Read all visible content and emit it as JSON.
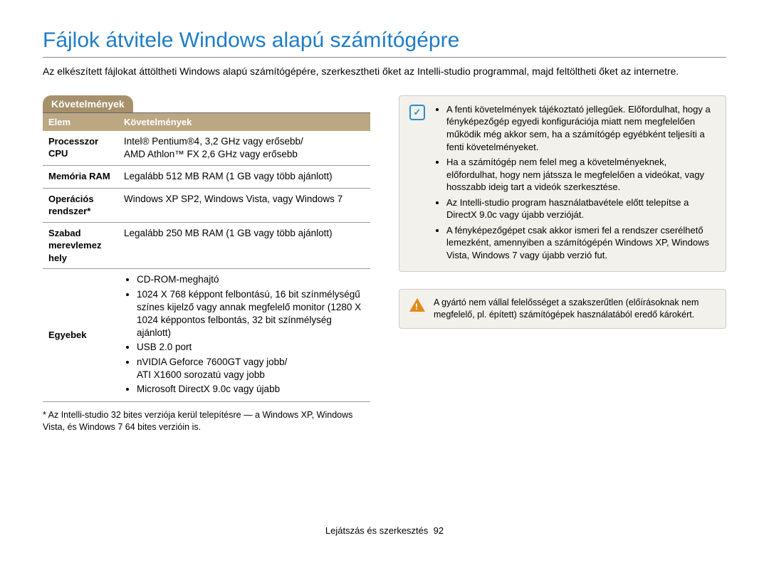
{
  "title": "Fájlok átvitele Windows alapú számítógépre",
  "intro": "Az elkészített fájlokat áttöltheti Windows alapú számítógépére, szerkesztheti őket az Intelli-studio programmal, majd feltöltheti őket az internetre.",
  "requirements": {
    "section_label": "Követelmények",
    "header_item": "Elem",
    "header_req": "Követelmények",
    "rows": [
      {
        "item": "Processzor CPU",
        "req": "Intel® Pentium®4, 3,2 GHz vagy erősebb/\nAMD Athlon™ FX 2,6 GHz vagy erősebb"
      },
      {
        "item": "Memória RAM",
        "req": "Legalább 512 MB RAM (1 GB vagy több ajánlott)"
      },
      {
        "item": "Operációs rendszer*",
        "req": "Windows XP SP2, Windows Vista, vagy Windows 7"
      },
      {
        "item": "Szabad merevlemez hely",
        "req": "Legalább 250 MB RAM (1 GB vagy több ajánlott)"
      }
    ],
    "others_label": "Egyebek",
    "others": [
      "CD-ROM-meghajtó",
      "1024 X 768 képpont felbontású, 16 bit színmélységű színes kijelző vagy annak megfelelő monitor (1280 X 1024 képpontos felbontás, 32 bit színmélység ajánlott)",
      "USB 2.0 port",
      "nVIDIA Geforce 7600GT vagy jobb/\nATI X1600 sorozatú vagy jobb",
      "Microsoft DirectX 9.0c vagy újabb"
    ],
    "footnote": "* Az Intelli-studio 32 bites verziója kerül telepítésre — a Windows XP, Windows Vista, és Windows 7 64 bites verzióin is."
  },
  "info_notes": [
    "A fenti követelmények tájékoztató jellegűek. Előfordulhat, hogy a fényképezőgép egyedi konfigurációja miatt nem megfelelően működik még akkor sem, ha a számítógép egyébként teljesíti a fenti követelményeket.",
    "Ha a számítógép nem felel meg a követelményeknek, előfordulhat, hogy nem játssza le megfelelően a videókat, vagy hosszabb ideig tart a videók szerkesztése.",
    "Az Intelli-studio program használatbavétele előtt telepítse a DirectX 9.0c vagy újabb verzióját.",
    "A fényképezőgépet csak akkor ismeri fel a rendszer cserélhető lemezként, amennyiben a számítógépén Windows XP, Windows Vista, Windows 7 vagy újabb verzió fut."
  ],
  "warn_note": "A gyártó nem vállal felelősséget a szakszerűtlen (előírásoknak nem megfelelő, pl. épített) számítógépek használatából eredő károkért.",
  "footer_section": "Lejátszás és szerkesztés",
  "footer_page": "92"
}
